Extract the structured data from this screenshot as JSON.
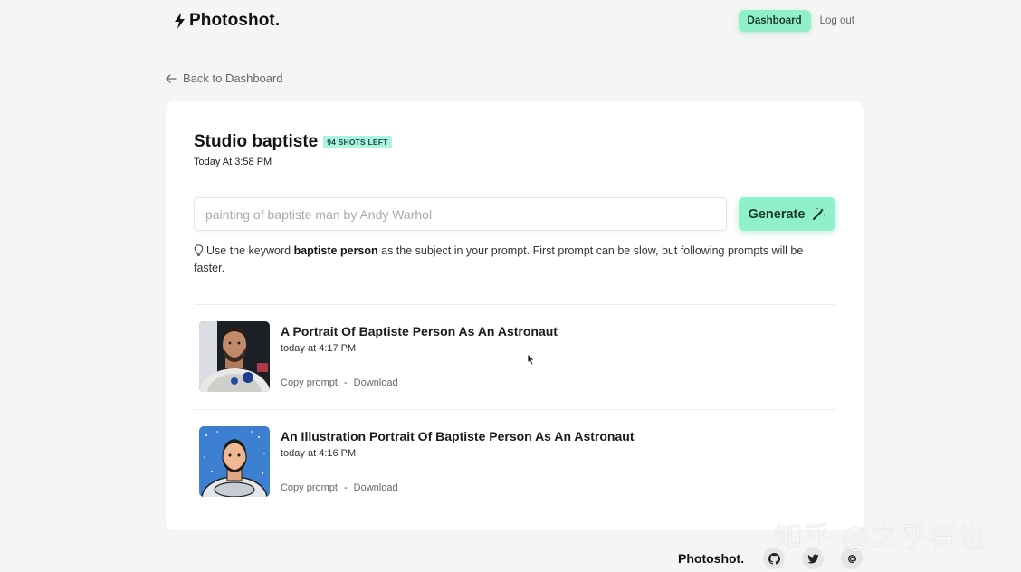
{
  "header": {
    "brand": "Photoshot.",
    "dashboard_label": "Dashboard",
    "logout_label": "Log out"
  },
  "back_link": {
    "label": "Back to Dashboard"
  },
  "studio": {
    "title": "Studio baptiste",
    "shots_left_badge": "94 SHOTS LEFT",
    "created": "Today At 3:58 PM"
  },
  "prompt": {
    "placeholder": "painting of baptiste man by Andy Warhol",
    "value": "",
    "generate_label": "Generate"
  },
  "hint": {
    "prefix": "Use the keyword ",
    "keyword": "baptiste person",
    "suffix": " as the subject in your prompt. First prompt can be slow, but following prompts will be faster."
  },
  "shots": [
    {
      "title": "A Portrait Of Baptiste Person As An Astronaut",
      "date": "today at 4:17 PM",
      "copy_label": "Copy prompt",
      "separator": "-",
      "download_label": "Download"
    },
    {
      "title": "An Illustration Portrait Of Baptiste Person As An Astronaut",
      "date": "today at 4:16 PM",
      "copy_label": "Copy prompt",
      "separator": "-",
      "download_label": "Download"
    }
  ],
  "footer": {
    "brand": "Photoshot.",
    "icons": [
      "github-icon",
      "twitter-icon",
      "email-icon"
    ]
  },
  "watermark": "知乎 @之乎者也",
  "colors": {
    "accent": "#8ff0c9",
    "badge_bg": "#aef2df",
    "background": "#f5f5f5"
  }
}
